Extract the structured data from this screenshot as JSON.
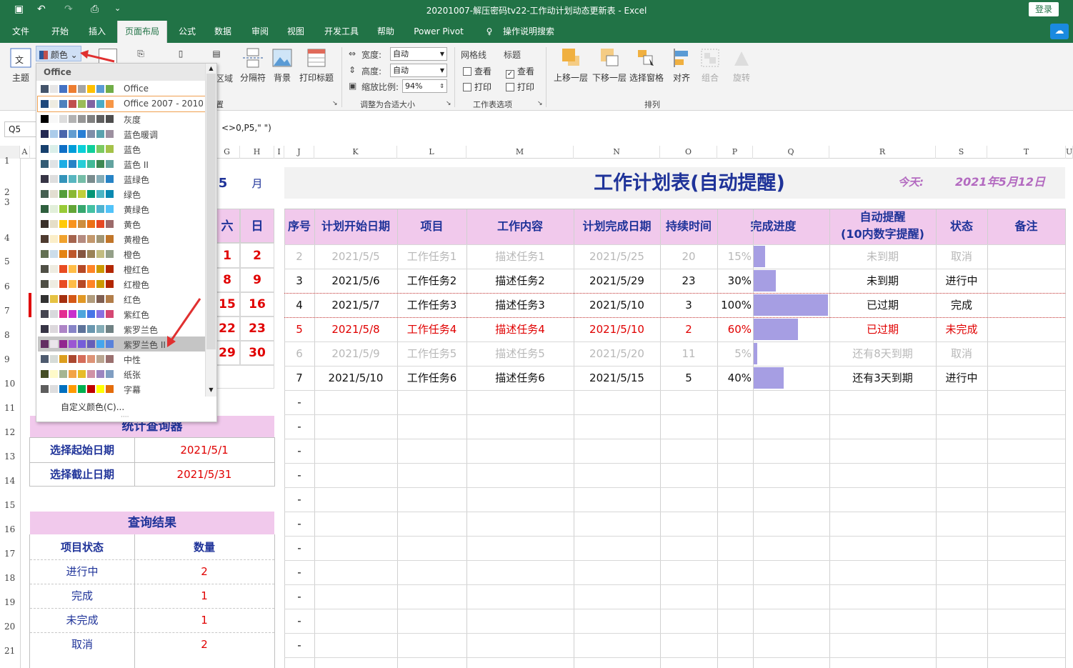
{
  "app": {
    "title": "20201007-解压密码tv22-工作动计划动态更新表  -  Excel",
    "login": "登录"
  },
  "tabs": [
    "文件",
    "开始",
    "插入",
    "页面布局",
    "公式",
    "数据",
    "审阅",
    "视图",
    "开发工具",
    "帮助",
    "Power Pivot",
    "操作说明搜索"
  ],
  "active_tab": "页面布局",
  "ribbon": {
    "theme": "主题",
    "colors": "颜色",
    "area": "区域",
    "breaks": "分隔符",
    "background": "背景",
    "print_titles": "打印标题",
    "page_setup_group": "置",
    "width_label": "宽度:",
    "width_value": "自动",
    "height_label": "高度:",
    "height_value": "自动",
    "scale_label": "缩放比例:",
    "scale_value": "94%",
    "scale_group": "调整为合适大小",
    "gridlines": "网格线",
    "headings": "标题",
    "view": "查看",
    "print": "打印",
    "sheet_group": "工作表选项",
    "bring_forward": "上移一层",
    "send_backward": "下移一层",
    "selection_pane": "选择窗格",
    "align": "对齐",
    "group": "组合",
    "rotate": "旋转",
    "arrange_group": "排列"
  },
  "formula": {
    "namebox": "Q5",
    "text": "<>0,P5,\" \")"
  },
  "columns": [
    "A",
    "G",
    "H",
    "I",
    "J",
    "K",
    "L",
    "M",
    "N",
    "O",
    "P",
    "Q",
    "R",
    "S",
    "T",
    "U"
  ],
  "rows": [
    "1",
    "2",
    "3",
    "4",
    "5",
    "6",
    "7",
    "8",
    "9",
    "10",
    "11",
    "12",
    "13",
    "14",
    "15",
    "16",
    "17",
    "18",
    "19",
    "20",
    "21"
  ],
  "calendar": {
    "month_num": "5",
    "month_unit": "月",
    "sat": "六",
    "sun": "日",
    "rows": [
      [
        "1",
        "2"
      ],
      [
        "8",
        "9"
      ],
      [
        "15",
        "16"
      ],
      [
        "22",
        "23"
      ],
      [
        "29",
        "30"
      ]
    ]
  },
  "query": {
    "title": "统计查询器",
    "start_label": "选择起始日期",
    "start_value": "2021/5/1",
    "end_label": "选择截止日期",
    "end_value": "2021/5/31"
  },
  "result": {
    "title": "查询结果",
    "col1": "项目状态",
    "col2": "数量",
    "rows": [
      [
        "进行中",
        "2"
      ],
      [
        "完成",
        "1"
      ],
      [
        "未完成",
        "1"
      ],
      [
        "取消",
        "2"
      ]
    ]
  },
  "plan": {
    "title": "工作计划表(自动提醒)",
    "today_label": "今天:",
    "today_value": "2021年5月12日",
    "headers": [
      "序号",
      "计划开始日期",
      "项目",
      "工作内容",
      "计划完成日期",
      "持续时间",
      "完成进度",
      "自动提醒",
      "(10内数字提醒)",
      "状态",
      "备注"
    ],
    "rows": [
      {
        "seq": "2",
        "start": "2021/5/5",
        "item": "工作任务1",
        "desc": "描述任务1",
        "end": "2021/5/25",
        "dur": "20",
        "pct": "15%",
        "progress": 0.15,
        "remind": "未到期",
        "status": "取消",
        "style": "gray"
      },
      {
        "seq": "3",
        "start": "2021/5/6",
        "item": "工作任务2",
        "desc": "描述任务2",
        "end": "2021/5/29",
        "dur": "23",
        "pct": "30%",
        "progress": 0.3,
        "remind": "未到期",
        "status": "进行中",
        "style": "blk"
      },
      {
        "seq": "4",
        "start": "2021/5/7",
        "item": "工作任务3",
        "desc": "描述任务3",
        "end": "2021/5/10",
        "dur": "3",
        "pct": "100%",
        "progress": 1.0,
        "remind": "已过期",
        "status": "完成",
        "style": "blk"
      },
      {
        "seq": "5",
        "start": "2021/5/8",
        "item": "工作任务4",
        "desc": "描述任务4",
        "end": "2021/5/10",
        "dur": "2",
        "pct": "60%",
        "progress": 0.6,
        "remind": "已过期",
        "status": "未完成",
        "style": "red"
      },
      {
        "seq": "6",
        "start": "2021/5/9",
        "item": "工作任务5",
        "desc": "描述任务5",
        "end": "2021/5/20",
        "dur": "11",
        "pct": "5%",
        "progress": 0.05,
        "remind": "还有8天到期",
        "status": "取消",
        "style": "gray"
      },
      {
        "seq": "7",
        "start": "2021/5/10",
        "item": "工作任务6",
        "desc": "描述任务6",
        "end": "2021/5/15",
        "dur": "5",
        "pct": "40%",
        "progress": 0.4,
        "remind": "还有3天到期",
        "status": "进行中",
        "style": "blk"
      }
    ],
    "empty_mark": "-"
  },
  "dropdown": {
    "header": "Office",
    "custom": "自定义颜色(C)...",
    "selected": "紫罗兰色 II",
    "highlighted": "Office 2007 - 2010",
    "schemes": [
      {
        "name": "Office",
        "colors": [
          "#44546a",
          "#e7e6e6",
          "#4472c4",
          "#ed7d31",
          "#a5a5a5",
          "#ffc000",
          "#5b9bd5",
          "#70ad47"
        ]
      },
      {
        "name": "Office 2007 - 2010",
        "colors": [
          "#1f497d",
          "#eeece1",
          "#4f81bd",
          "#c0504d",
          "#9bbb59",
          "#8064a2",
          "#4bacc6",
          "#f79646"
        ]
      },
      {
        "name": "灰度",
        "colors": [
          "#000000",
          "#f8f8f8",
          "#dddddd",
          "#b2b2b2",
          "#969696",
          "#808080",
          "#5f5f5f",
          "#4d4d4d"
        ]
      },
      {
        "name": "蓝色暖调",
        "colors": [
          "#242852",
          "#acccea",
          "#4a66ac",
          "#629dd1",
          "#297fd5",
          "#7f8fa9",
          "#5aa2ae",
          "#9d90a0"
        ]
      },
      {
        "name": "蓝色",
        "colors": [
          "#17406d",
          "#dbefe9",
          "#0f6fc6",
          "#009dd9",
          "#0bd0d9",
          "#10cf9b",
          "#7cca62",
          "#a5c249"
        ]
      },
      {
        "name": "蓝色 II",
        "colors": [
          "#335b74",
          "#dfe3e5",
          "#1cade4",
          "#2683c6",
          "#27ced7",
          "#42ba97",
          "#3e8853",
          "#62a39f"
        ]
      },
      {
        "name": "蓝绿色",
        "colors": [
          "#373545",
          "#dedede",
          "#3494ba",
          "#58b6c0",
          "#75bda7",
          "#7a8c8e",
          "#84acb6",
          "#2683c6"
        ]
      },
      {
        "name": "绿色",
        "colors": [
          "#455f51",
          "#e3ded1",
          "#549e39",
          "#8ab833",
          "#c0cf3a",
          "#029676",
          "#4ab5c4",
          "#0989b1"
        ]
      },
      {
        "name": "黄绿色",
        "colors": [
          "#2f5f3e",
          "#e2efda",
          "#99cb38",
          "#63a537",
          "#37a76f",
          "#44c1a3",
          "#4eb3cf",
          "#51c3f9"
        ]
      },
      {
        "name": "黄色",
        "colors": [
          "#39302a",
          "#e5dec8",
          "#ffca08",
          "#f8931d",
          "#ce8d3e",
          "#ec7016",
          "#e64823",
          "#9c6a6a"
        ]
      },
      {
        "name": "黄橙色",
        "colors": [
          "#4e3b30",
          "#fbeec9",
          "#f0a22e",
          "#a5644e",
          "#b58b80",
          "#c3986d",
          "#a19574",
          "#c17529"
        ]
      },
      {
        "name": "橙色",
        "colors": [
          "#637052",
          "#ccddea",
          "#e48312",
          "#bd582c",
          "#865640",
          "#9b8357",
          "#c2bc80",
          "#94a088"
        ]
      },
      {
        "name": "橙红色",
        "colors": [
          "#505046",
          "#eeece1",
          "#e84c22",
          "#ffbd47",
          "#b64926",
          "#ff8427",
          "#cc9900",
          "#b22600"
        ]
      },
      {
        "name": "红橙色",
        "colors": [
          "#505046",
          "#eeece1",
          "#e84c22",
          "#ffbd47",
          "#b64926",
          "#ff8427",
          "#cc9900",
          "#b22600"
        ]
      },
      {
        "name": "红色",
        "colors": [
          "#323232",
          "#e5c243",
          "#a5300f",
          "#d55816",
          "#e19825",
          "#b19c7d",
          "#7f5f52",
          "#b27d49"
        ]
      },
      {
        "name": "紫红色",
        "colors": [
          "#454551",
          "#d8d9dc",
          "#e32d91",
          "#c830cc",
          "#4ea6dc",
          "#4775e7",
          "#8971e1",
          "#d54773"
        ]
      },
      {
        "name": "紫罗兰色",
        "colors": [
          "#373545",
          "#dcd8dc",
          "#ad84c6",
          "#8784c7",
          "#5d739a",
          "#6997af",
          "#84acb6",
          "#6f8183"
        ]
      },
      {
        "name": "紫罗兰色 II",
        "colors": [
          "#632e62",
          "#eae5eb",
          "#92278f",
          "#9b57d3",
          "#755dd9",
          "#665eb8",
          "#45a5ed",
          "#5982db"
        ]
      },
      {
        "name": "中性",
        "colors": [
          "#4e5b6f",
          "#d6dbd7",
          "#dc9e1f",
          "#ab4830",
          "#d66d5a",
          "#dd9377",
          "#b9a590",
          "#9a6f6e"
        ]
      },
      {
        "name": "纸张",
        "colors": [
          "#444d26",
          "#fefac9",
          "#a5b592",
          "#f3a447",
          "#e7bc29",
          "#d092a7",
          "#9c85c0",
          "#809ec2"
        ]
      },
      {
        "name": "字幕",
        "colors": [
          "#5e5e5e",
          "#ddddde",
          "#0070c0",
          "#ff9900",
          "#00b050",
          "#c00000",
          "#ffff00",
          "#e46c0a"
        ]
      }
    ]
  }
}
